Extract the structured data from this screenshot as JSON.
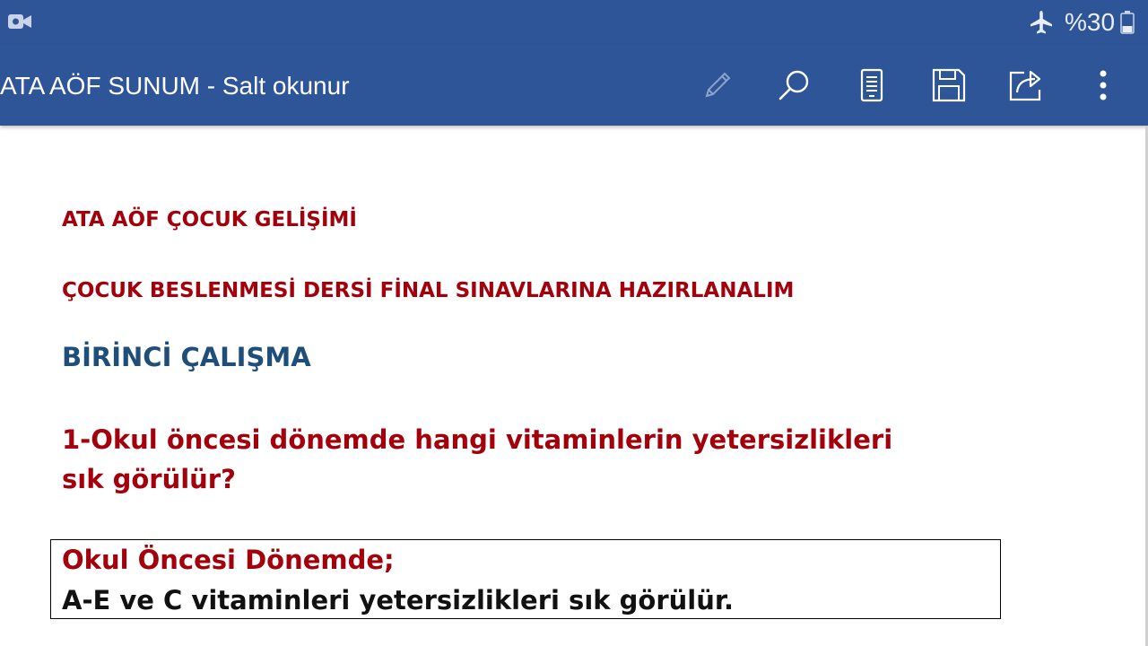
{
  "status_bar": {
    "battery_text": "%30",
    "icons": [
      "video-call-icon",
      "airplane-mode-icon",
      "battery-icon"
    ]
  },
  "app_bar": {
    "document_title": "ATA AÖF SUNUM - Salt okunur",
    "actions": [
      "pencil-icon",
      "search-icon",
      "reading-mode-icon",
      "save-icon",
      "share-icon",
      "more-options-icon"
    ]
  },
  "document": {
    "heading1": "ATA AÖF ÇOCUK GELİŞİMİ",
    "heading2": "ÇOCUK BESLENMESİ DERSİ FİNAL SINAVLARINA HAZIRLANALIM",
    "heading3": "BİRİNCİ ÇALIŞMA",
    "question": "1-Okul öncesi dönemde hangi vitaminlerin yetersizlikleri sık görülür?",
    "answer_title": "Okul Öncesi Dönemde;",
    "answer_text": "A-E ve C vitaminleri yetersizlikleri sık görülür."
  },
  "colors": {
    "app_bar": "#2e5597",
    "red_text": "#a3000c",
    "blue_text": "#1f4e79"
  }
}
